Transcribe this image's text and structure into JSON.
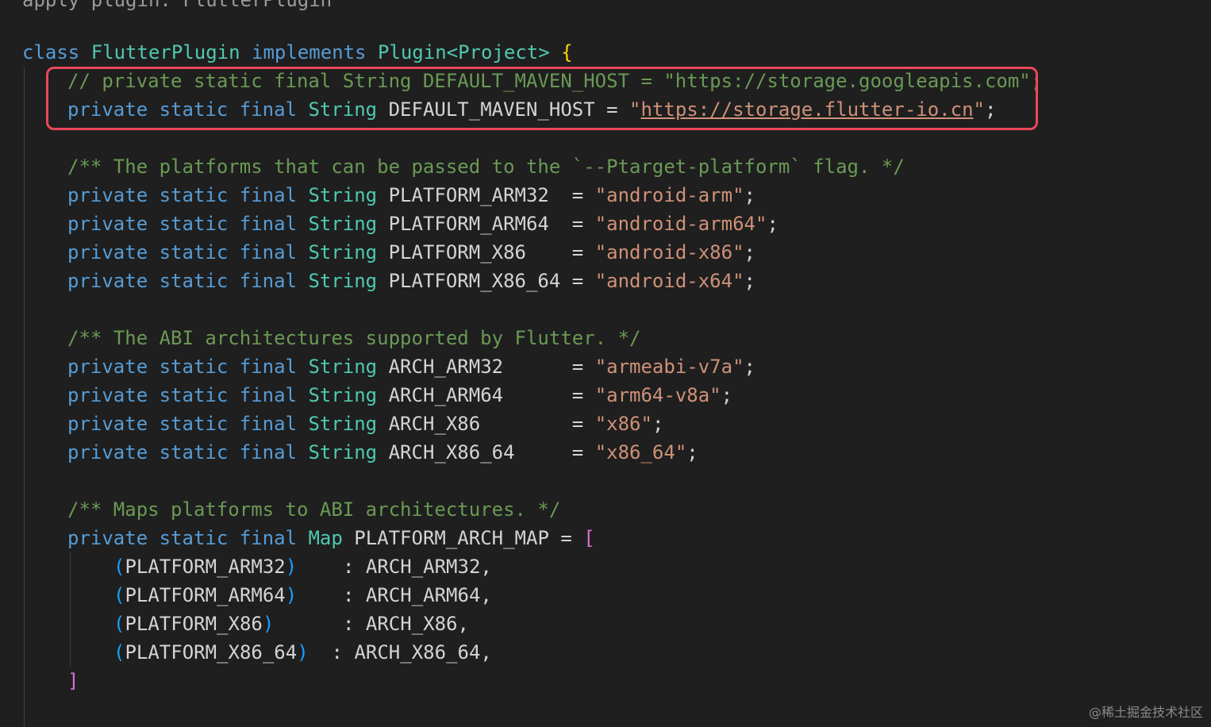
{
  "partial_top_line": "apply plugin: FlutterPlugin",
  "class_decl": {
    "keyword": "class",
    "name": "FlutterPlugin",
    "implements": "implements",
    "iface": "Plugin<Project>",
    "brace": "{"
  },
  "highlight": {
    "commented_line": "// private static final String DEFAULT_MAVEN_HOST = \"https://storage.googleapis.com\";",
    "active": {
      "mods": "private static final",
      "type": "String",
      "name": "DEFAULT_MAVEN_HOST =",
      "q1": "\"",
      "url": "https://storage.flutter-io.cn",
      "q2": "\"",
      "semi": ";"
    }
  },
  "platforms_comment": "/** The platforms that can be passed to the `--Ptarget-platform` flag. */",
  "platforms": [
    {
      "mods": "private static final",
      "type": "String",
      "name": "PLATFORM_ARM32  =",
      "value": "\"android-arm\"",
      "semi": ";"
    },
    {
      "mods": "private static final",
      "type": "String",
      "name": "PLATFORM_ARM64  =",
      "value": "\"android-arm64\"",
      "semi": ";"
    },
    {
      "mods": "private static final",
      "type": "String",
      "name": "PLATFORM_X86    =",
      "value": "\"android-x86\"",
      "semi": ";"
    },
    {
      "mods": "private static final",
      "type": "String",
      "name": "PLATFORM_X86_64 =",
      "value": "\"android-x64\"",
      "semi": ";"
    }
  ],
  "abi_comment": "/** The ABI architectures supported by Flutter. */",
  "archs": [
    {
      "mods": "private static final",
      "type": "String",
      "name": "ARCH_ARM32      =",
      "value": "\"armeabi-v7a\"",
      "semi": ";"
    },
    {
      "mods": "private static final",
      "type": "String",
      "name": "ARCH_ARM64      =",
      "value": "\"arm64-v8a\"",
      "semi": ";"
    },
    {
      "mods": "private static final",
      "type": "String",
      "name": "ARCH_X86        =",
      "value": "\"x86\"",
      "semi": ";"
    },
    {
      "mods": "private static final",
      "type": "String",
      "name": "ARCH_X86_64     =",
      "value": "\"x86_64\"",
      "semi": ";"
    }
  ],
  "map_comment": "/** Maps platforms to ABI architectures. */",
  "map_decl": {
    "mods": "private static final",
    "type": "Map",
    "name": "PLATFORM_ARCH_MAP =",
    "open": "["
  },
  "map_entries": [
    {
      "open": "(",
      "key": "PLATFORM_ARM32",
      "close": ")",
      "sep": "    : ",
      "value": "ARCH_ARM32,"
    },
    {
      "open": "(",
      "key": "PLATFORM_ARM64",
      "close": ")",
      "sep": "    : ",
      "value": "ARCH_ARM64,"
    },
    {
      "open": "(",
      "key": "PLATFORM_X86",
      "close": ")",
      "sep": "      : ",
      "value": "ARCH_X86,"
    },
    {
      "open": "(",
      "key": "PLATFORM_X86_64",
      "close": ")",
      "sep": "  : ",
      "value": "ARCH_X86_64,"
    }
  ],
  "map_close": "]",
  "watermark": "@稀土掘金技术社区",
  "colors": {
    "background": "#1f1f1f",
    "keyword": "#569cd6",
    "type": "#4ec9b0",
    "string": "#ce9178",
    "comment": "#6a9955",
    "highlight_border": "#e9485a"
  }
}
